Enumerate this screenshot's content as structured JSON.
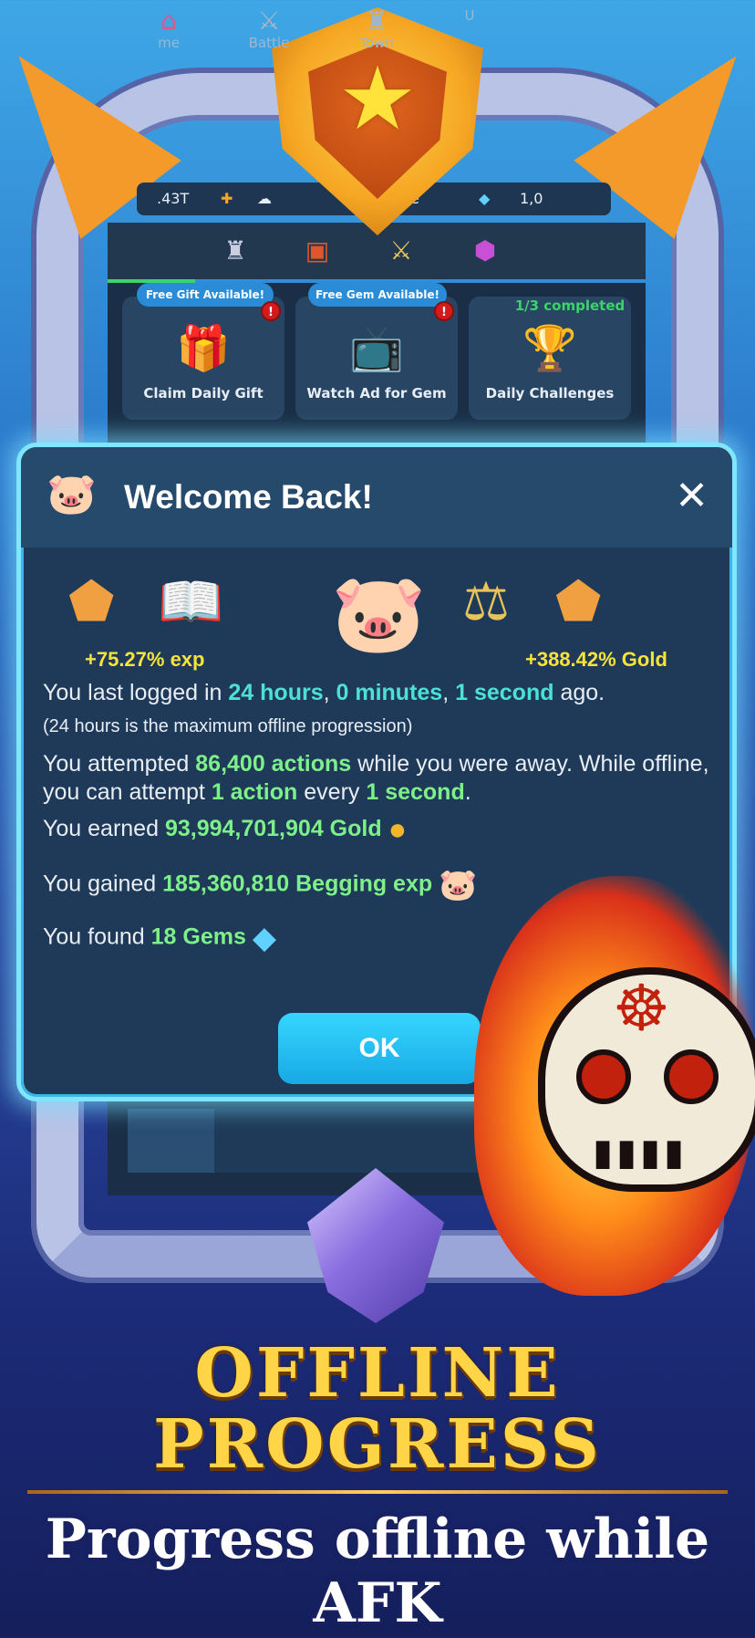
{
  "top_bar": {
    "currency_1": ".43T",
    "currency_3_partial": "e",
    "gems": "1,0"
  },
  "tab_icons": [
    "castle-icon",
    "chest-icon",
    "swords-icon",
    "dice-icon"
  ],
  "cards": [
    {
      "pill": "Free Gift Available!",
      "label": "Claim Daily Gift",
      "alert": "!",
      "icon": "gift-icon"
    },
    {
      "pill": "Free Gem Available!",
      "label": "Watch Ad for Gem",
      "alert": "!",
      "icon": "tv-icon"
    },
    {
      "progress_text": "1/3 completed",
      "label": "Daily Challenges",
      "icon": "trophy-icon"
    }
  ],
  "dialog": {
    "title": "Welcome Back!",
    "close_symbol": "✕",
    "exp_bonus": "+75.27% exp",
    "gold_bonus": "+388.42% Gold",
    "line1": {
      "pre": "You last logged in ",
      "hours": "24 hours",
      "sep1": ", ",
      "minutes": "0 minutes",
      "sep2": ", ",
      "seconds": "1 second",
      "post": " ago."
    },
    "line2": "(24 hours is the maximum offline progression)",
    "line3": {
      "pre": "You attempted ",
      "actions": "86,400 actions",
      "mid": " while you were away. While offline, you can attempt ",
      "rate": "1 action",
      "every": " every ",
      "interval": "1 second",
      "post": "."
    },
    "line4": {
      "pre": "You earned ",
      "value": "93,994,701,904 Gold"
    },
    "line5": {
      "pre": "You gained ",
      "value": "185,360,810 Begging exp"
    },
    "line6": {
      "pre": "You found ",
      "value": "18 Gems"
    },
    "ok_label": "OK"
  },
  "bottom_nav": [
    {
      "label": "me",
      "icon": "shop-icon"
    },
    {
      "label": "Battle",
      "icon": "swords-icon"
    },
    {
      "label": "Town",
      "icon": "castle-icon"
    },
    {
      "label": "U",
      "icon": ""
    }
  ],
  "headline": {
    "line1": "OFFLINE",
    "line2": "PROGRESS"
  },
  "subline": "Progress offline while AFK",
  "colors": {
    "accent_cyan": "#4ce0d9",
    "accent_green": "#7df08a",
    "bonus_yellow": "#f5e43a",
    "ok_button": "#17a9e5",
    "headline_gold": "#ffd447"
  }
}
